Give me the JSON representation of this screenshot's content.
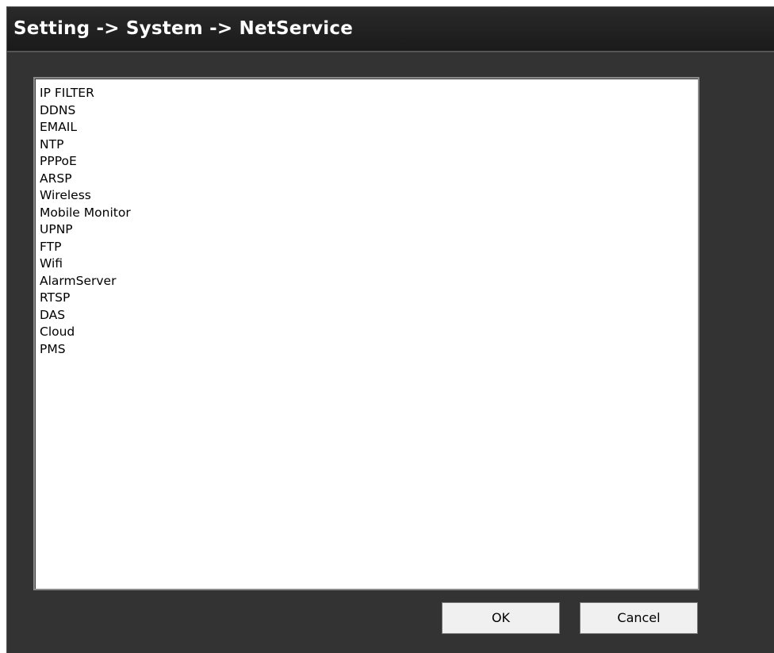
{
  "window": {
    "title": "Setting -> System -> NetService"
  },
  "services": [
    "IP FILTER",
    "DDNS",
    "EMAIL",
    "NTP",
    "PPPoE",
    "ARSP",
    "Wireless",
    "Mobile Monitor",
    "UPNP",
    "FTP",
    "Wifi",
    "AlarmServer",
    "RTSP",
    "DAS",
    "Cloud",
    "PMS"
  ],
  "buttons": {
    "ok_label": "OK",
    "cancel_label": "Cancel"
  },
  "colors": {
    "window_bg": "#333333",
    "titlebar_bg": "#1a1a1a",
    "title_text": "#ffffff",
    "list_bg": "#ffffff",
    "button_bg": "#f0f0f0"
  }
}
